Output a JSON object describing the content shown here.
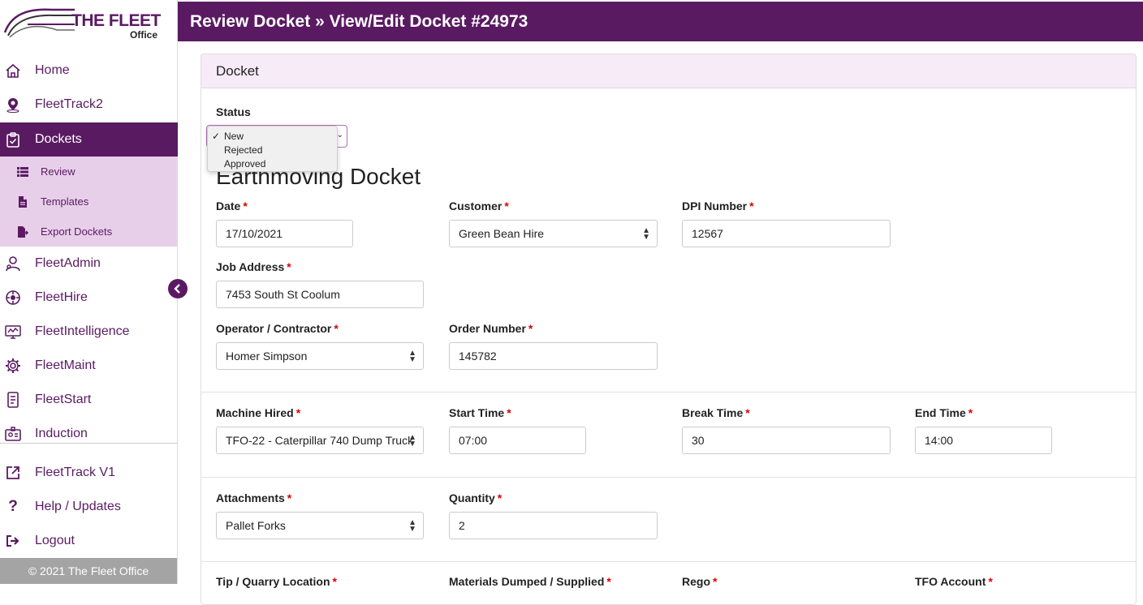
{
  "app": {
    "brand": "THE FLEET",
    "brand_sub": "Office"
  },
  "header": {
    "title": "Review Docket » View/Edit Docket #24973"
  },
  "sidebar": {
    "items": [
      {
        "label": "Home",
        "icon": "home-icon"
      },
      {
        "label": "FleetTrack2",
        "icon": "location-pin-icon"
      },
      {
        "label": "Dockets",
        "icon": "clipboard-icon",
        "active": true
      },
      {
        "label": "FleetAdmin",
        "icon": "admin-user-icon"
      },
      {
        "label": "FleetHire",
        "icon": "hire-icon"
      },
      {
        "label": "FleetIntelligence",
        "icon": "analytics-icon"
      },
      {
        "label": "FleetMaint",
        "icon": "gear-icon"
      },
      {
        "label": "FleetStart",
        "icon": "checklist-icon"
      },
      {
        "label": "Induction",
        "icon": "id-card-icon"
      }
    ],
    "subitems": [
      {
        "label": "Review",
        "icon": "list-icon"
      },
      {
        "label": "Templates",
        "icon": "file-icon"
      },
      {
        "label": "Export Dockets",
        "icon": "file-export-icon"
      }
    ],
    "bottom_items": [
      {
        "label": "FleetTrack V1",
        "icon": "external-link-icon"
      },
      {
        "label": "Help / Updates",
        "icon": "question-icon"
      },
      {
        "label": "Logout",
        "icon": "logout-icon"
      }
    ],
    "footer": "© 2021 The Fleet Office"
  },
  "card": {
    "title": "Docket",
    "status_label": "Status",
    "status_options": [
      "New",
      "Rejected",
      "Approved"
    ],
    "status_selected": "New",
    "section_title": "Earthmoving Docket",
    "fields": {
      "date": {
        "label": "Date",
        "value": "17/10/2021"
      },
      "customer": {
        "label": "Customer",
        "value": "Green Bean Hire"
      },
      "dpi_number": {
        "label": "DPI Number",
        "value": "12567"
      },
      "job_address": {
        "label": "Job Address",
        "value": "7453 South St Coolum"
      },
      "operator": {
        "label": "Operator / Contractor",
        "value": "Homer Simpson"
      },
      "order_number": {
        "label": "Order Number",
        "value": "145782"
      },
      "machine": {
        "label": "Machine Hired",
        "value": "TFO-22 - Caterpillar 740 Dump Truck"
      },
      "start_time": {
        "label": "Start Time",
        "value": "07:00"
      },
      "break_time": {
        "label": "Break Time",
        "value": "30"
      },
      "end_time": {
        "label": "End Time",
        "value": "14:00"
      },
      "attachments": {
        "label": "Attachments",
        "value": "Pallet Forks"
      },
      "quantity": {
        "label": "Quantity",
        "value": "2"
      },
      "tip_location": {
        "label": "Tip / Quarry Location"
      },
      "materials": {
        "label": "Materials Dumped / Supplied"
      },
      "rego": {
        "label": "Rego"
      },
      "tfo_account": {
        "label": "TFO Account"
      }
    },
    "required_mark": "*"
  },
  "colors": {
    "primary": "#5a1a62",
    "submenu_bg": "#e8cfe9",
    "card_header_bg": "#f7ebf8",
    "required": "#dd0000"
  }
}
